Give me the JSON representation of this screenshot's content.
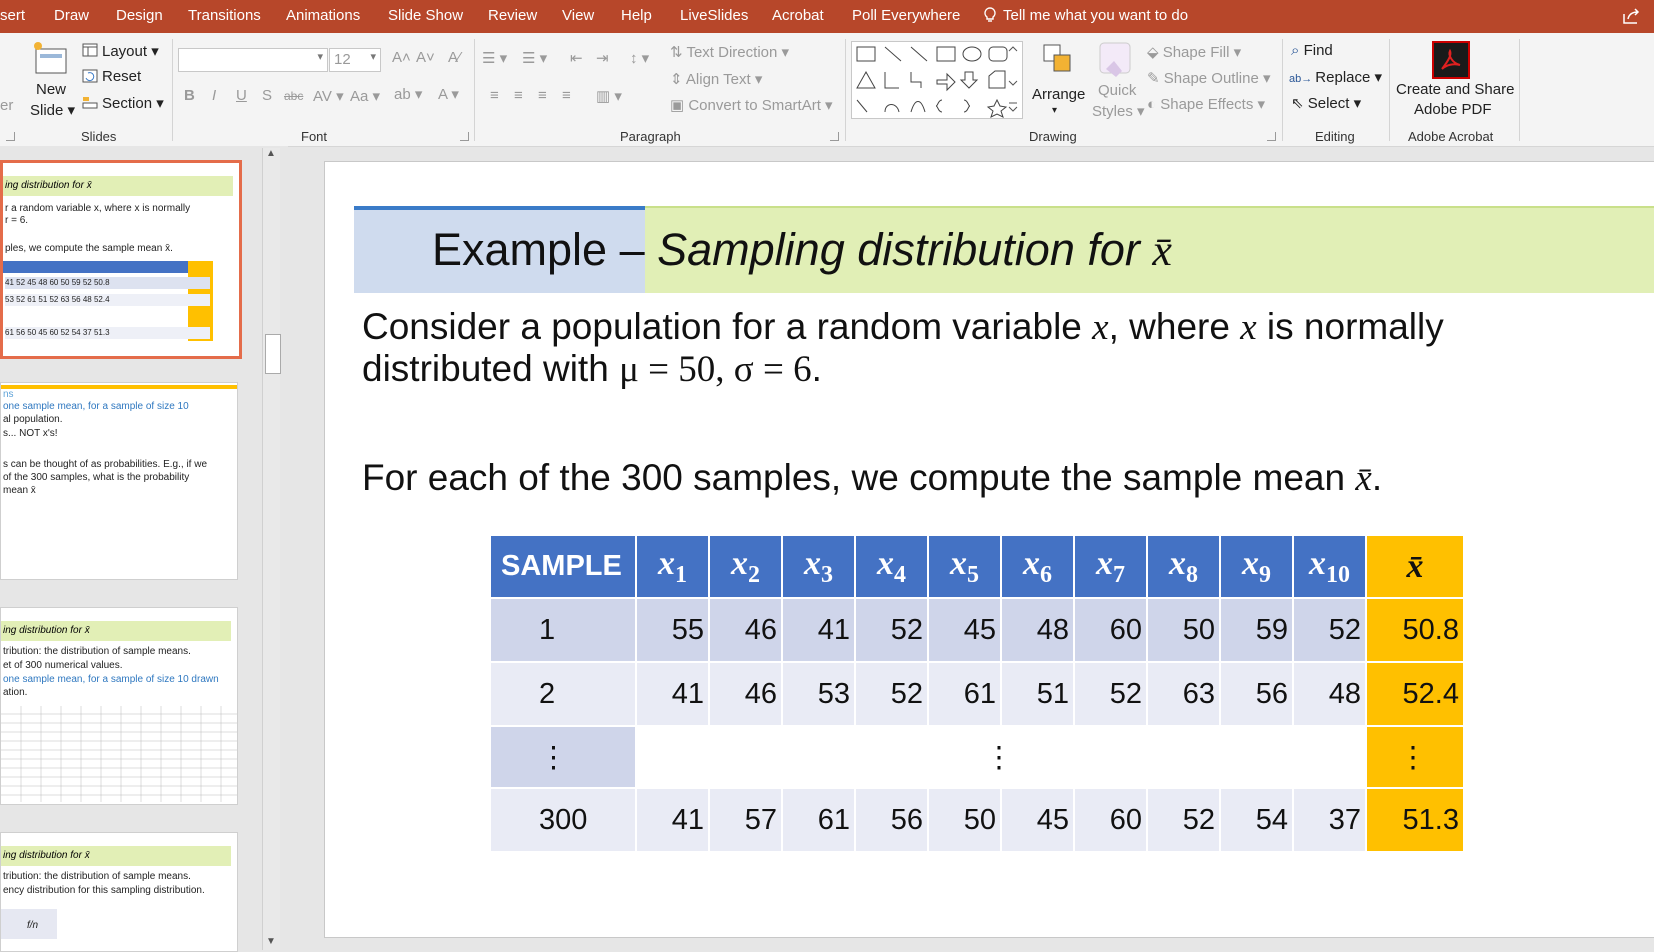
{
  "ribbon_tabs": [
    "sert",
    "Draw",
    "Design",
    "Transitions",
    "Animations",
    "Slide Show",
    "Review",
    "View",
    "Help",
    "LiveSlides",
    "Acrobat",
    "Poll Everywhere"
  ],
  "tell_me": "Tell me what you want to do",
  "slides_group": {
    "new_slide": "New",
    "new_slide_2": "Slide",
    "layout": "Layout",
    "reset": "Reset",
    "section": "Section",
    "label": "Slides"
  },
  "font_group": {
    "font_name": "",
    "font_size": "12",
    "label": "Font"
  },
  "paragraph_group": {
    "text_direction": "Text Direction",
    "align_text": "Align Text",
    "convert_smartart": "Convert to SmartArt",
    "label": "Paragraph"
  },
  "drawing_group": {
    "arrange": "Arrange",
    "quick_styles": "Quick",
    "quick_styles_2": "Styles",
    "shape_fill": "Shape Fill",
    "shape_outline": "Shape Outline",
    "shape_effects": "Shape Effects",
    "label": "Drawing"
  },
  "editing_group": {
    "find": "Find",
    "replace": "Replace",
    "select": "Select",
    "label": "Editing"
  },
  "acrobat_group": {
    "create_share": "Create and Share",
    "adobe_pdf": "Adobe PDF",
    "label": "Adobe Acrobat"
  },
  "thumbnails": [
    {
      "title": "ing distribution for x̄",
      "lines": [
        "r a random variable x, where x is normally",
        "r = 6.",
        "ples, we compute the sample mean x̄."
      ],
      "rows": [
        "41 52 45 48 60 50 59 52 50.8",
        "53 52 61 51 52 63 56 48 52.4",
        "61 56 50 45 60 52 54 37 51.3"
      ]
    },
    {
      "lines": [
        "ns",
        "one sample mean, for a sample of size 10",
        "al population.",
        "s... NOT x's!",
        "s can be thought of as probabilities. E.g., if we",
        "of the 300 samples, what is the probability",
        "mean x̄"
      ]
    },
    {
      "title": "ing distribution for x̄",
      "lines": [
        "tribution: the distribution of sample means.",
        "et of 300 numerical values.",
        "one sample mean, for a sample of size 10 drawn",
        "ation."
      ]
    },
    {
      "title": "ing distribution for x̄",
      "lines": [
        "tribution: the distribution of sample means.",
        "ency distribution for this sampling distribution."
      ],
      "col_label": "f/n"
    }
  ],
  "slide": {
    "title_plain": "Example – ",
    "title_italic": "Sampling distribution for ",
    "title_symbol": "x̄",
    "para1_a": "Consider a population for a random variable ",
    "para1_var1": "x",
    "para1_b": ", where ",
    "para1_var2": "x",
    "para1_c": " is normally",
    "para2_a": "distributed with ",
    "para2_math": "μ = 50, σ = 6",
    "para2_b": ".",
    "para3_a": "For each of the 300 samples, we compute the sample mean ",
    "para3_sym": "x̄",
    "para3_b": "."
  },
  "table": {
    "header_sample": "SAMPLE",
    "header_x": [
      "1",
      "2",
      "3",
      "4",
      "5",
      "6",
      "7",
      "8",
      "9",
      "10"
    ],
    "header_var": "x",
    "header_mean": "x̄",
    "rows": [
      {
        "sample": "1",
        "values": [
          "55",
          "46",
          "41",
          "52",
          "45",
          "48",
          "60",
          "50",
          "59",
          "52"
        ],
        "mean": "50.8"
      },
      {
        "sample": "2",
        "values": [
          "41",
          "46",
          "53",
          "52",
          "61",
          "51",
          "52",
          "63",
          "56",
          "48"
        ],
        "mean": "52.4"
      },
      {
        "sample": "⋮",
        "middle": "⋮",
        "mean": "⋮"
      },
      {
        "sample": "300",
        "values": [
          "41",
          "57",
          "61",
          "56",
          "50",
          "45",
          "60",
          "52",
          "54",
          "37"
        ],
        "mean": "51.3"
      }
    ]
  }
}
